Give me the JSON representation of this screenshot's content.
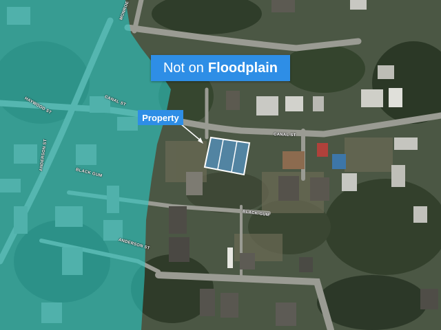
{
  "banner": {
    "prefix": "Not on",
    "emphasis": "Floodplain"
  },
  "property_label": "Property",
  "streets": {
    "canal_left": "CANAL ST",
    "canal_right": "CANAL ST",
    "haywood": "HAYWOOD ST",
    "anderson_vertical": "ANDERSON ST",
    "anderson_bottom": "ANDERSON ST",
    "black_gum_left": "BLACK GUM",
    "black_gum_right": "BLACK GUM",
    "top_left_street": "MONROE ST"
  },
  "colors": {
    "floodplain_overlay": "#2cc7c2",
    "callout_bg": "#2e8ee6",
    "parcel_outline": "#ffffff",
    "parcel_fill": "#5aa9f0"
  }
}
